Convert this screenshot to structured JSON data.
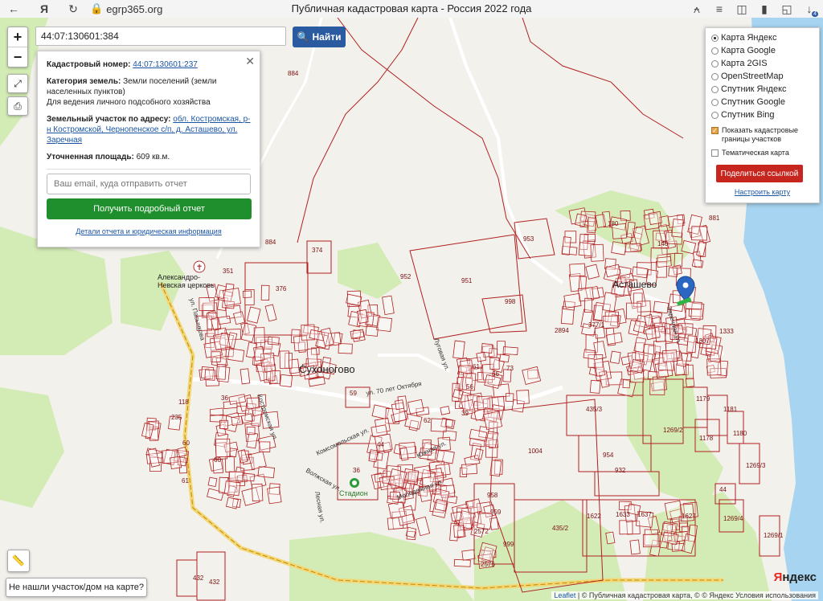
{
  "browser": {
    "url": "egrp365.org",
    "title": "Публичная кадастровая карта - Россия 2022 года",
    "downloads_badge": "4",
    "icons": [
      "back-icon",
      "yandex-icon",
      "reload-icon",
      "lock-icon",
      "headphones-icon",
      "reader-icon",
      "tabs-icon",
      "bookmark-icon",
      "collections-icon",
      "download-icon"
    ]
  },
  "search": {
    "value": "44:07:130601:384",
    "button_label": "Найти",
    "icon": "search-icon"
  },
  "info": {
    "cadastral_label": "Кадастровый номер:",
    "cadastral_value": "44:07:130601:237",
    "category_label": "Категория земель:",
    "category_value": "Земли поселений (земли населенных пунктов)",
    "usage": "Для ведения личного подсобного хозяйства",
    "address_label": "Земельный участок по адресу:",
    "address_value": "обл. Костромская, р-н Костромской, Чернопенское с/п, д. Асташево, ул. Заречная",
    "area_label": "Уточненная площадь:",
    "area_value": "609 кв.м.",
    "email_placeholder": "Ваш email, куда отправить отчет",
    "report_button": "Получить подробный отчет",
    "details_link": "Детали отчета и юридическая информация"
  },
  "layers": {
    "options": [
      {
        "label": "Карта Яндекс",
        "selected": true
      },
      {
        "label": "Карта Google",
        "selected": false
      },
      {
        "label": "Карта 2GIS",
        "selected": false
      },
      {
        "label": "OpenStreetMap",
        "selected": false
      },
      {
        "label": "Спутник Яндекс",
        "selected": false
      },
      {
        "label": "Спутник Google",
        "selected": false
      },
      {
        "label": "Спутник Bing",
        "selected": false
      }
    ],
    "show_boundaries_label": "Показать кадастровые границы участков",
    "show_boundaries": true,
    "thematic_label": "Тематическая карта",
    "thematic": false,
    "share_button": "Поделиться ссылкой",
    "setup_link": "Настроить карту"
  },
  "map_controls": {
    "zoom_in": "+",
    "zoom_out": "−",
    "not_found_button": "Не нашли участок/дом на карте?"
  },
  "map_labels": {
    "places": [
      "Сухоногово",
      "Асташево",
      "Александро-Невская церковь",
      "Стадион"
    ],
    "streets": [
      "ул. Пасынкова",
      "ул. 70 лет Октября",
      "Комсомольская ул.",
      "Костромская ул.",
      "Лесная ул.",
      "Волжская ул.",
      "Молодежная ул.",
      "Луговая ул.",
      "Южная ул.",
      "Заречная ул."
    ],
    "parcels": [
      "884",
      "884",
      "374",
      "376",
      "351",
      "951",
      "953",
      "998",
      "952",
      "2894",
      "881",
      "180",
      "140",
      "377/1",
      "1333",
      "1307",
      "59",
      "118",
      "36",
      "235",
      "60",
      "60",
      "61",
      "62",
      "44",
      "36",
      "1004",
      "954",
      "932",
      "435/3",
      "435/2",
      "958",
      "959",
      "999",
      "2572",
      "2576",
      "1622",
      "1633",
      "1637",
      "1627",
      "1179",
      "1181",
      "1178",
      "1180",
      "1269/2",
      "1269/3",
      "1269/4",
      "1269/1",
      "44",
      "432",
      "432",
      "56",
      "66",
      "73",
      "61",
      "39"
    ]
  },
  "attribution": {
    "leaflet": "Leaflet",
    "text": "© Публичная кадастровая карта, ©",
    "yandex_terms": "© Яндекс Условия использования",
    "logo_ya": "Я",
    "logo_rest": "ндекс"
  }
}
